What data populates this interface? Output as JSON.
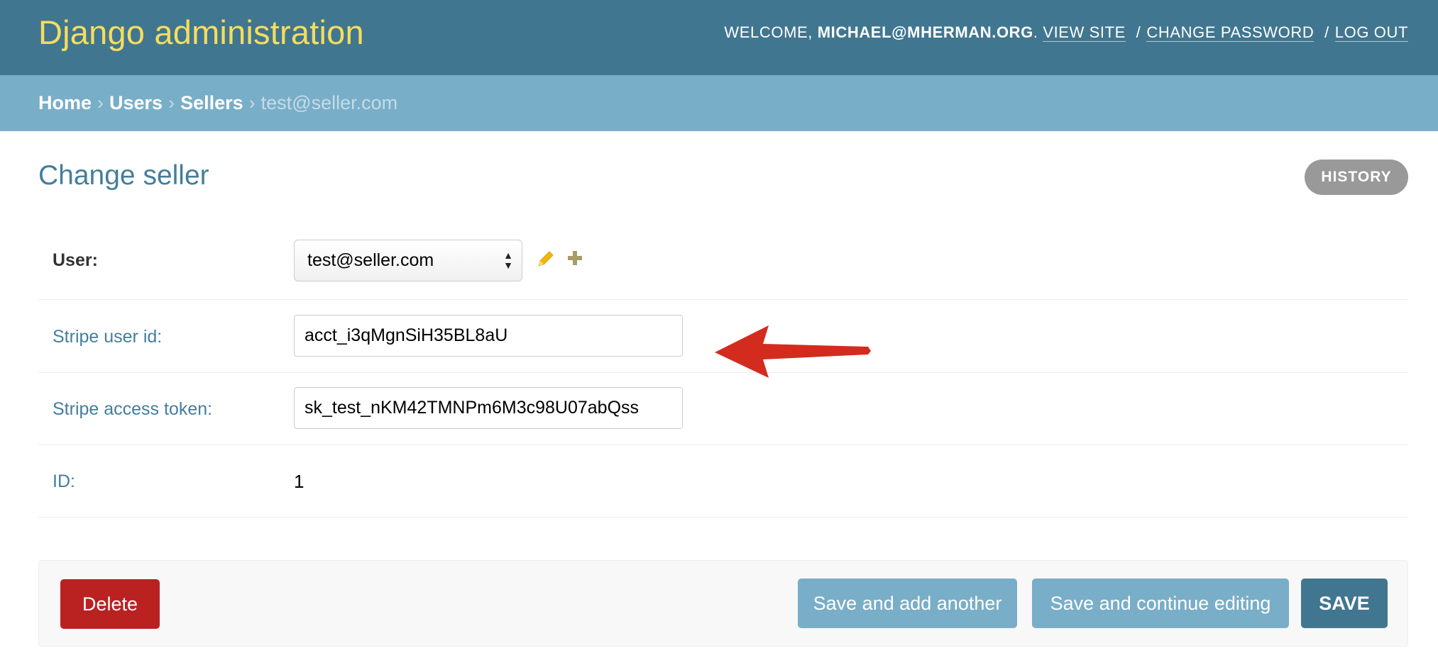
{
  "header": {
    "branding": "Django administration",
    "welcome_prefix": "WELCOME,",
    "username": "MICHAEL@MHERMAN.ORG",
    "username_suffix": ".",
    "view_site": "VIEW SITE",
    "change_password": "CHANGE PASSWORD",
    "log_out": "LOG OUT",
    "separator": "/"
  },
  "breadcrumbs": {
    "items": [
      "Home",
      "Users",
      "Sellers"
    ],
    "current": "test@seller.com",
    "separator": "›"
  },
  "page": {
    "title": "Change seller",
    "history_button": "HISTORY"
  },
  "form": {
    "user": {
      "label": "User:",
      "selected": "test@seller.com"
    },
    "stripe_user_id": {
      "label": "Stripe user id:",
      "value": "acct_i3qMgnSiH35BL8aU"
    },
    "stripe_access_token": {
      "label": "Stripe access token:",
      "value": "sk_test_nKM42TMNPm6M3c98U07abQss"
    },
    "id": {
      "label": "ID:",
      "value": "1"
    }
  },
  "actions": {
    "delete": "Delete",
    "save_add_another": "Save and add another",
    "save_continue": "Save and continue editing",
    "save": "SAVE"
  },
  "colors": {
    "header_bg": "#417690",
    "branding": "#f5dd5d",
    "breadcrumbs_bg": "#79aec8",
    "delete_bg": "#ba2121",
    "annotation_arrow": "#d42b1f"
  },
  "icons": {
    "change_related": "pencil-icon",
    "add_related": "plus-icon",
    "select_arrows": "select-arrows-icon",
    "annotation": "red-arrow-annotation"
  }
}
